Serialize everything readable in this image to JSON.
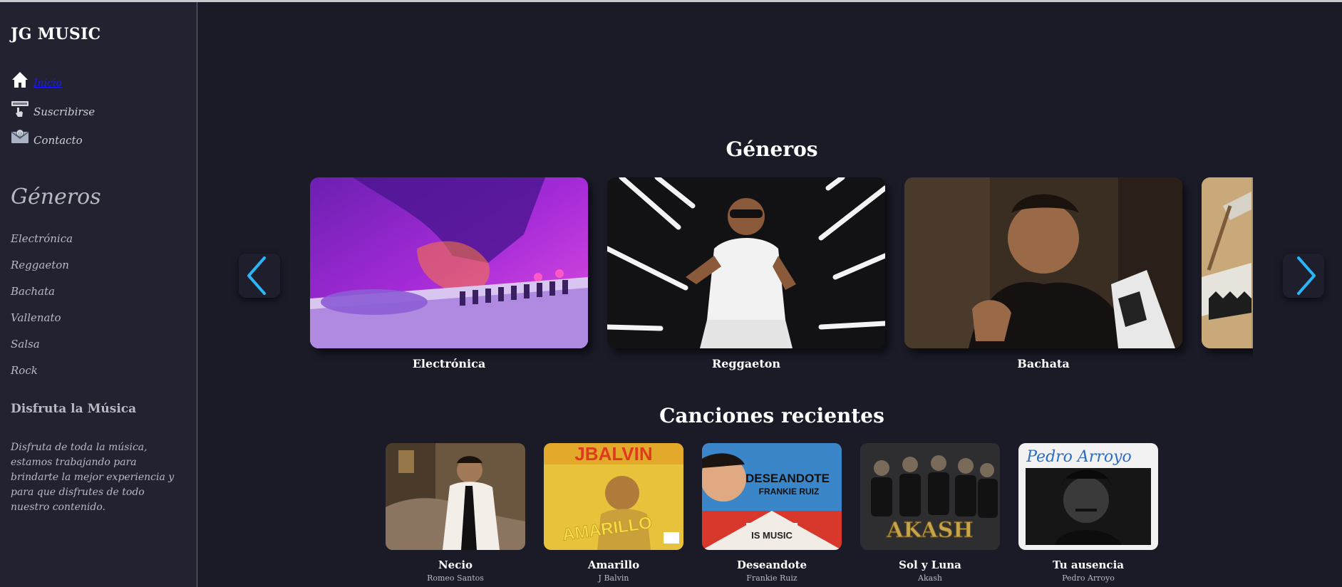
{
  "brand": "JG MUSIC",
  "nav": [
    {
      "label": "Inicio",
      "icon": "home-icon",
      "active": true
    },
    {
      "label": "Suscribirse",
      "icon": "subscribe-icon"
    },
    {
      "label": "Contacto",
      "icon": "mail-icon"
    }
  ],
  "sidebar_genres_title": "Géneros",
  "sidebar_genres": [
    "Electrónica",
    "Reggaeton",
    "Bachata",
    "Vallenato",
    "Salsa",
    "Rock"
  ],
  "enjoy": {
    "title": "Disfruta la Música",
    "text": "Disfruta de toda la música, estamos trabajando para brindarte la mejor experiencia y para que disfrutes de todo nuestro contenido."
  },
  "genres_section_title": "Géneros",
  "genre_cards": [
    {
      "label": "Electrónica"
    },
    {
      "label": "Reggaeton"
    },
    {
      "label": "Bachata"
    }
  ],
  "recent_section_title": "Canciones recientes",
  "songs": [
    {
      "title": "Necio",
      "artist": "Romeo Santos"
    },
    {
      "title": "Amarillo",
      "artist": "J Balvin"
    },
    {
      "title": "Deseandote",
      "artist": "Frankie Ruiz"
    },
    {
      "title": "Sol y Luna",
      "artist": "Akash"
    },
    {
      "title": "Tu ausencia",
      "artist": "Pedro Arroyo"
    }
  ],
  "cover_text": {
    "amarillo_artist": "JBALVIN",
    "amarillo_title": "AMARILLO",
    "deseandote_title": "DESEANDOTE",
    "deseandote_artist": "FRANKIE RUIZ",
    "deseandote_logo": "IS MUSIC",
    "akash_logo": "AKASH",
    "pedro_signature": "Pedro Arroyo"
  },
  "colors": {
    "background": "#1b1b28",
    "sidebar": "#222230",
    "arrow_accent": "#29b6f6",
    "active_link": "#1a1aff"
  }
}
